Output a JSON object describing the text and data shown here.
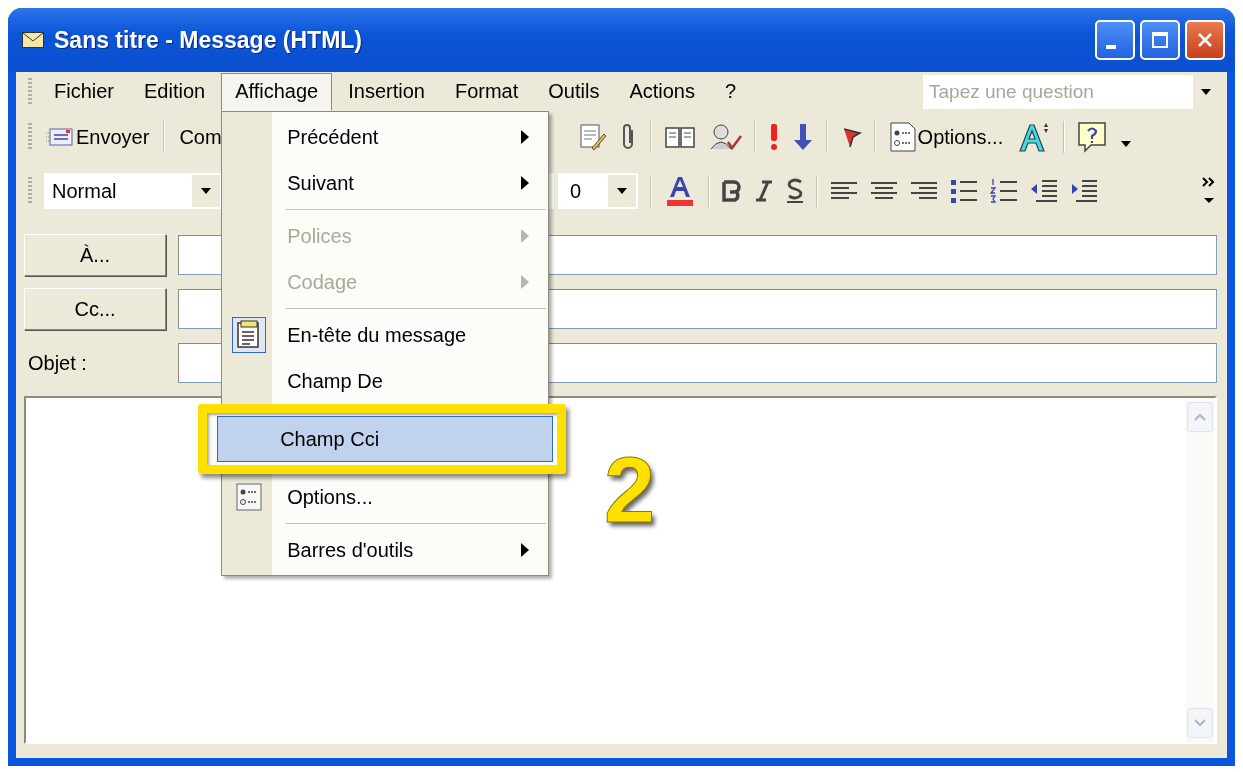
{
  "window": {
    "title": "Sans titre - Message (HTML)"
  },
  "menu_bar": {
    "items": [
      {
        "label": "Fichier",
        "selected": false
      },
      {
        "label": "Edition",
        "selected": false
      },
      {
        "label": "Affichage",
        "selected": true
      },
      {
        "label": "Insertion",
        "selected": false
      },
      {
        "label": "Format",
        "selected": false
      },
      {
        "label": "Outils",
        "selected": false
      },
      {
        "label": "Actions",
        "selected": false
      },
      {
        "label": "?",
        "selected": false
      }
    ]
  },
  "help_search": {
    "placeholder": "Tapez une question"
  },
  "standard_toolbar": {
    "send": "Envoyer",
    "accounts": "Com",
    "options": "Options..."
  },
  "formatting_toolbar": {
    "style": "Normal",
    "font_size": "0"
  },
  "header_fields": {
    "to": "À...",
    "cc": "Cc...",
    "subject_label": "Objet :"
  },
  "view_menu": {
    "items": [
      {
        "kind": "submenu",
        "label": "Précédent",
        "disabled": false,
        "selected": false
      },
      {
        "kind": "submenu",
        "label": "Suivant",
        "disabled": false,
        "selected": false
      },
      {
        "kind": "separator"
      },
      {
        "kind": "submenu",
        "label": "Polices",
        "disabled": true,
        "selected": false
      },
      {
        "kind": "submenu",
        "label": "Codage",
        "disabled": true,
        "selected": false
      },
      {
        "kind": "separator"
      },
      {
        "kind": "toggle",
        "label": "En-tête du message",
        "checked": true,
        "selected": false
      },
      {
        "kind": "toggle",
        "label": "Champ De",
        "checked": false,
        "selected": false
      },
      {
        "kind": "toggle",
        "label": "Champ Cci",
        "checked": false,
        "selected": true
      },
      {
        "kind": "dialog",
        "label": "Options...",
        "selected": false
      },
      {
        "kind": "separator"
      },
      {
        "kind": "submenu",
        "label": "Barres d'outils",
        "disabled": false,
        "selected": false
      }
    ]
  },
  "annotation": {
    "step": "2"
  }
}
